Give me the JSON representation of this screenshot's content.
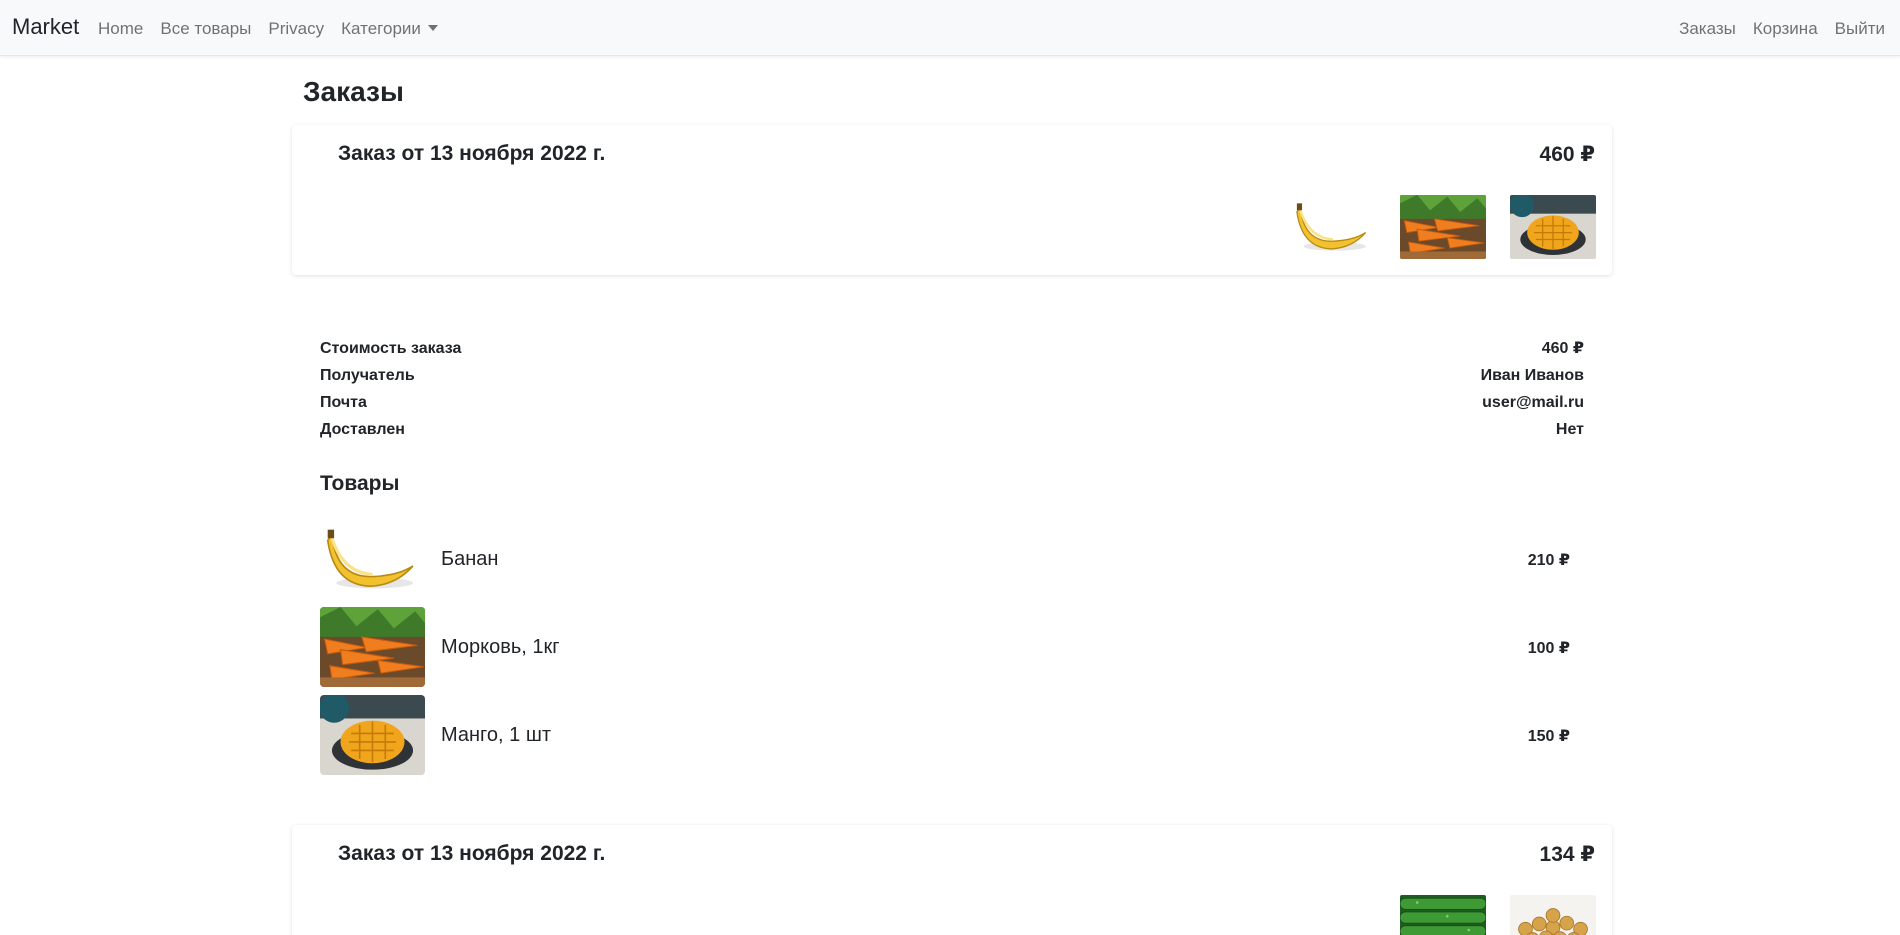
{
  "navbar": {
    "brand": "Market",
    "left_links": [
      "Home",
      "Все товары",
      "Privacy",
      "Категории"
    ],
    "right_links": [
      "Заказы",
      "Корзина",
      "Выйти"
    ]
  },
  "page": {
    "title": "Заказы"
  },
  "orders": [
    {
      "title": "Заказ от 13 ноября 2022 г.",
      "total": "460 ₽",
      "thumbnails": [
        "banana-image",
        "carrot-image",
        "mango-image"
      ]
    },
    {
      "title": "Заказ от 13 ноября 2022 г.",
      "total": "134 ₽",
      "thumbnails": [
        "cucumber-image",
        "nuts-image"
      ]
    }
  ],
  "details": {
    "rows": [
      {
        "label": "Стоимость заказа",
        "value": "460 ₽"
      },
      {
        "label": "Получатель",
        "value": "Иван Иванов"
      },
      {
        "label": "Почта",
        "value": "user@mail.ru"
      },
      {
        "label": "Доставлен",
        "value": "Нет"
      }
    ],
    "goods_title": "Товары",
    "items": [
      {
        "name": "Банан",
        "price": "210 ₽",
        "image": "banana-image"
      },
      {
        "name": "Морковь, 1кг",
        "price": "100 ₽",
        "image": "carrot-image"
      },
      {
        "name": "Манго, 1 шт",
        "price": "150 ₽",
        "image": "mango-image"
      }
    ]
  },
  "colors": {
    "navbar_bg": "#f8f9fa",
    "nav_text": "#6c757d",
    "text": "#212529"
  }
}
